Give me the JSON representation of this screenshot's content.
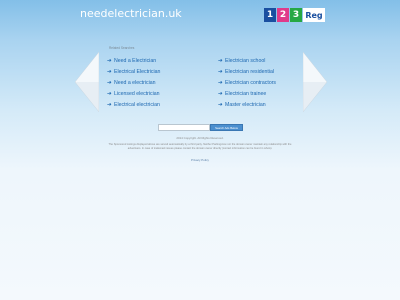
{
  "header": {
    "domain": "needelectrician.uk",
    "logo": {
      "digits": [
        "1",
        "2",
        "3"
      ],
      "word": "Reg",
      "colors": [
        "#1a4fa0",
        "#e03a8a",
        "#27a844"
      ]
    }
  },
  "related": {
    "label": "Related Searches",
    "left": [
      "Need a Electrician",
      "Electrical Electrician",
      "Need a electrician",
      "Licensed electrician",
      "Electrical electrician"
    ],
    "right": [
      "Electrician school",
      "Electrician residential",
      "Electrician contractors",
      "Electrician trainee",
      "Master electrician"
    ]
  },
  "search": {
    "value": "",
    "button_label": "Search Ads Below"
  },
  "footer": {
    "copyright": "2014 Copyright. All Rights Reserved.",
    "disclaimer": "The Sponsored Listings displayed above are served automatically by a third party. Neither Parkingcrew nor the domain owner maintain any relationship with the advertisers. In case of trademark issues please contact the domain owner directly (contact information can be found in whois).",
    "privacy": "Privacy Policy"
  },
  "icons": {
    "left_nav": "left-chevron-icon",
    "right_nav": "right-chevron-icon",
    "link_bullet": "arrow-right-icon"
  },
  "colors": {
    "link": "#1c67b0",
    "header_top": "#83bfe8",
    "button": "#4b8fcf"
  }
}
